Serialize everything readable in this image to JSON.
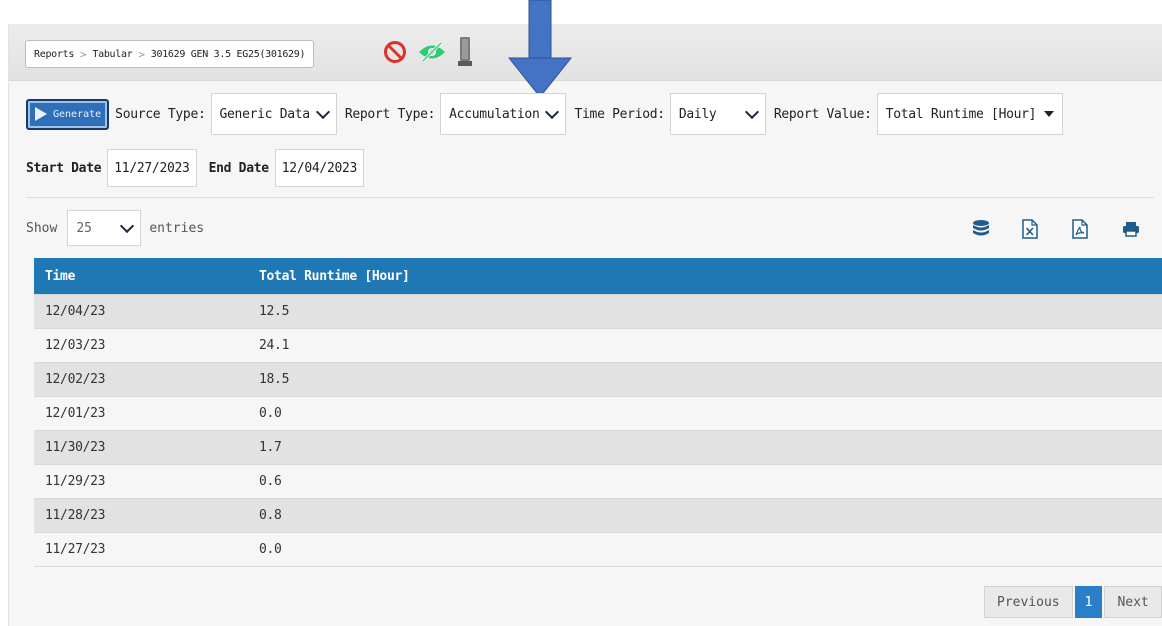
{
  "breadcrumb": {
    "items": [
      "Reports",
      "Tabular",
      "301629 GEN 3.5 EG25(301629)"
    ],
    "separator": ">"
  },
  "status_icons": [
    "block-icon",
    "hidden-eye-icon",
    "device-icon"
  ],
  "toolbar": {
    "generate_label": "Generate",
    "source_type_label": "Source Type:",
    "source_type_value": "Generic Data",
    "report_type_label": "Report Type:",
    "report_type_value": "Accumulation",
    "time_period_label": "Time Period:",
    "time_period_value": "Daily",
    "report_value_label": "Report Value:",
    "report_value_value": "Total Runtime [Hour]"
  },
  "dates": {
    "start_label": "Start Date",
    "start_value": "11/27/2023",
    "end_label": "End Date",
    "end_value": "12/04/2023"
  },
  "length": {
    "show_label": "Show",
    "value": "25",
    "entries_label": "entries"
  },
  "export_icons": [
    "database-icon",
    "excel-icon",
    "pdf-icon",
    "print-icon"
  ],
  "table": {
    "columns": [
      "Time",
      "Total Runtime [Hour]"
    ],
    "rows": [
      [
        "12/04/23",
        "12.5"
      ],
      [
        "12/03/23",
        "24.1"
      ],
      [
        "12/02/23",
        "18.5"
      ],
      [
        "12/01/23",
        "0.0"
      ],
      [
        "11/30/23",
        "1.7"
      ],
      [
        "11/29/23",
        "0.6"
      ],
      [
        "11/28/23",
        "0.8"
      ],
      [
        "11/27/23",
        "0.0"
      ]
    ]
  },
  "pagination": {
    "previous": "Previous",
    "current": "1",
    "next": "Next"
  },
  "colors": {
    "header_bg": "#1f78b4",
    "generate_bg": "#2f6fb8",
    "active_page": "#2a7fc6",
    "arrow": "#4472c4",
    "block_icon": "#e0302b",
    "eye_icon": "#2ecc71"
  }
}
